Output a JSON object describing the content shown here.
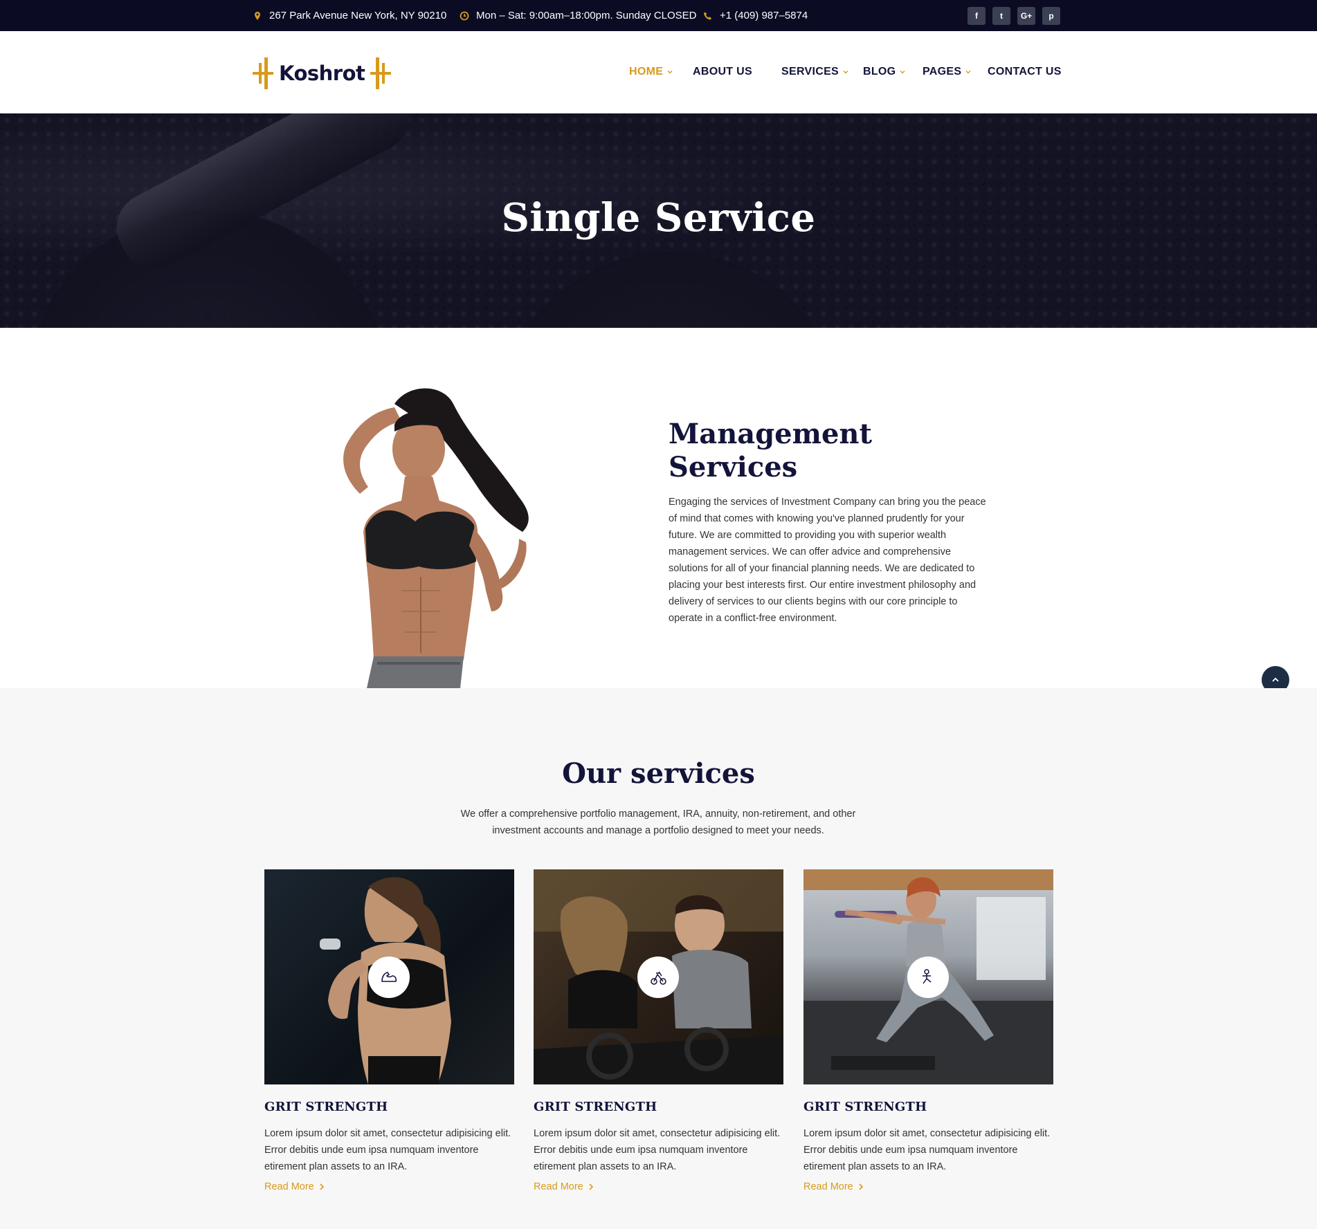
{
  "topbar": {
    "address": "267 Park Avenue New York, NY 90210",
    "hours": "Mon – Sat: 9:00am–18:00pm. Sunday CLOSED",
    "phone": "+1 (409) 987–5874",
    "socials": [
      "f",
      "t",
      "G+",
      "p"
    ],
    "icons": {
      "address": "map-pin-icon",
      "hours": "clock-icon",
      "phone": "phone-icon"
    }
  },
  "brand": {
    "name": "Koshrot",
    "accent": "#d89a1c",
    "dark": "#13143a"
  },
  "nav": {
    "items": [
      {
        "label": "HOME",
        "active": true,
        "dropdown": true
      },
      {
        "label": "ABOUT US",
        "active": false,
        "dropdown": false
      },
      {
        "label": "SERVICES",
        "active": false,
        "dropdown": true
      },
      {
        "label": "BLOG",
        "active": false,
        "dropdown": true
      },
      {
        "label": "PAGES",
        "active": false,
        "dropdown": true
      },
      {
        "label": "CONTACT US",
        "active": false,
        "dropdown": false
      }
    ]
  },
  "hero": {
    "title": "Single Service"
  },
  "management": {
    "title": "Management Services",
    "body": "Engaging the services of Investment Company can bring you the peace of mind that comes with knowing you've planned prudently for your future. We are committed to providing you with superior wealth management services. We can offer advice and comprehensive solutions for all of your financial planning needs. We are dedicated to placing your best interests first. Our entire investment philosophy and delivery of services to our clients begins with our core principle to operate in a conflict-free environment."
  },
  "services": {
    "title": "Our services",
    "intro": "We offer a comprehensive portfolio management, IRA, annuity, non-retirement, and other investment accounts and manage a portfolio designed to meet your needs.",
    "cards": [
      {
        "title": "GRIT STRENGTH",
        "text": "Lorem ipsum dolor sit amet, consectetur adipisicing elit. Error debitis unde eum ipsa numquam inventore etirement plan assets to an IRA.",
        "link": "Read More",
        "icon": "muscle-arm-icon"
      },
      {
        "title": "GRIT STRENGTH",
        "text": "Lorem ipsum dolor sit amet, consectetur adipisicing elit. Error debitis unde eum ipsa numquam inventore etirement plan assets to an IRA.",
        "link": "Read More",
        "icon": "exercise-bike-icon"
      },
      {
        "title": "GRIT STRENGTH",
        "text": "Lorem ipsum dolor sit amet, consectetur adipisicing elit. Error debitis unde eum ipsa numquam inventore etirement plan assets to an IRA.",
        "link": "Read More",
        "icon": "stretching-person-icon"
      }
    ]
  }
}
